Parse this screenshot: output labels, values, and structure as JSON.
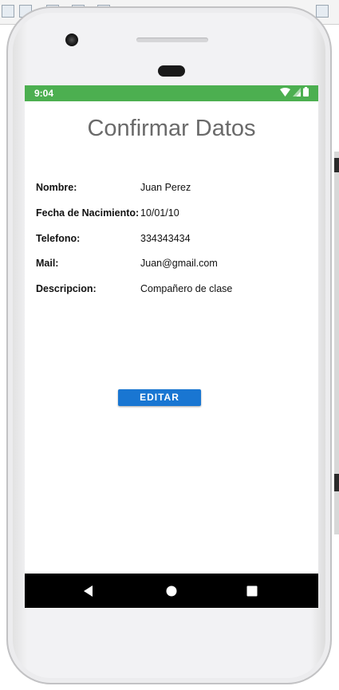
{
  "status_bar": {
    "time": "9:04",
    "color": "#4caf50",
    "icons": [
      "wifi-icon",
      "signal-icon",
      "battery-icon"
    ]
  },
  "screen": {
    "title": "Confirmar Datos",
    "fields": [
      {
        "label": "Nombre:",
        "value": "Juan Perez"
      },
      {
        "label": "Fecha de Nacimiento:",
        "value": "10/01/10"
      },
      {
        "label": "Telefono:",
        "value": "334343434"
      },
      {
        "label": "Mail:",
        "value": "Juan@gmail.com"
      },
      {
        "label": "Descripcion:",
        "value": "Compañero de clase"
      }
    ],
    "edit_button_label": "EDITAR",
    "accent_color": "#1976d2"
  },
  "nav_bar": {
    "buttons": [
      "back-icon",
      "home-icon",
      "recents-icon"
    ]
  }
}
